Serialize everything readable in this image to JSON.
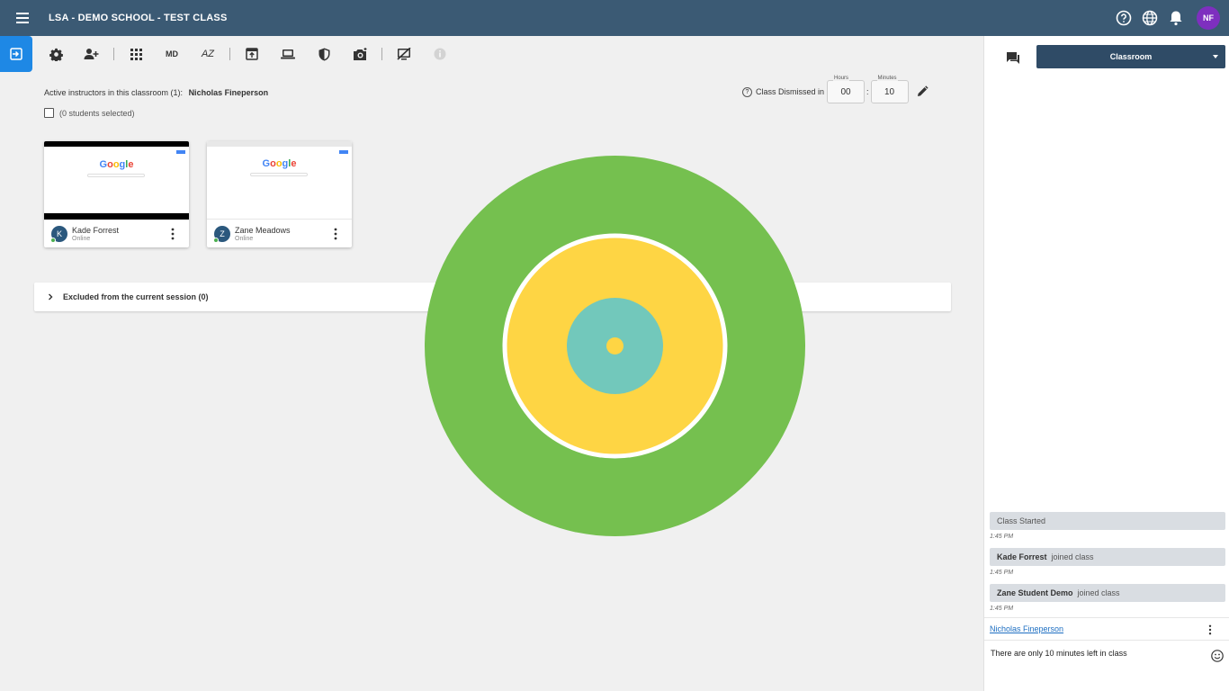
{
  "header": {
    "title": "LSA - DEMO SCHOOL - TEST CLASS",
    "avatar_initials": "NF",
    "icons": [
      "menu-icon",
      "help-icon",
      "globe-icon",
      "bell-icon"
    ]
  },
  "toolbar": {
    "sort_md_label": "MD",
    "sort_az_label": "AZ",
    "icons": [
      "exit-class-icon",
      "gear-icon",
      "add-student-icon",
      "grid-icon",
      "sort-md-icon",
      "sort-az-icon",
      "open-tab-icon",
      "laptop-icon",
      "shield-icon",
      "camera-icon",
      "screen-off-icon",
      "disabled-circle-icon"
    ]
  },
  "main": {
    "active_instructors_label": "Active instructors in this classroom (1):",
    "active_instructor_name": "Nicholas Fineperson",
    "students_selected": "(0 students selected)",
    "dismiss_label": "Class Dismissed in",
    "hours_label": "Hours",
    "hours_value": "00",
    "minutes_label": "Minutes",
    "minutes_value": "10",
    "colon": ":",
    "excluded_label": "Excluded from the current session (0)"
  },
  "students": [
    {
      "name": "Kade Forrest",
      "initial": "K",
      "status": "Online"
    },
    {
      "name": "Zane Meadows",
      "initial": "Z",
      "status": "Online"
    }
  ],
  "thumb_logo": [
    "G",
    "o",
    "o",
    "g",
    "l",
    "e"
  ],
  "target_colors": {
    "outer": "#75c04f",
    "ring": "#ffffff",
    "middle": "#fed544",
    "inner": "#72c8bb",
    "center": "#fed544"
  },
  "panel": {
    "selector_label": "Classroom",
    "messages": [
      {
        "bold": "",
        "text": "Class Started",
        "time": "1:45 PM"
      },
      {
        "bold": "Kade Forrest",
        "text": "joined class",
        "time": "1:45 PM"
      },
      {
        "bold": "Zane Student Demo",
        "text": "joined class",
        "time": "1:45 PM"
      }
    ],
    "author": "Nicholas Fineperson",
    "compose_text": "There are only 10 minutes left in class"
  }
}
